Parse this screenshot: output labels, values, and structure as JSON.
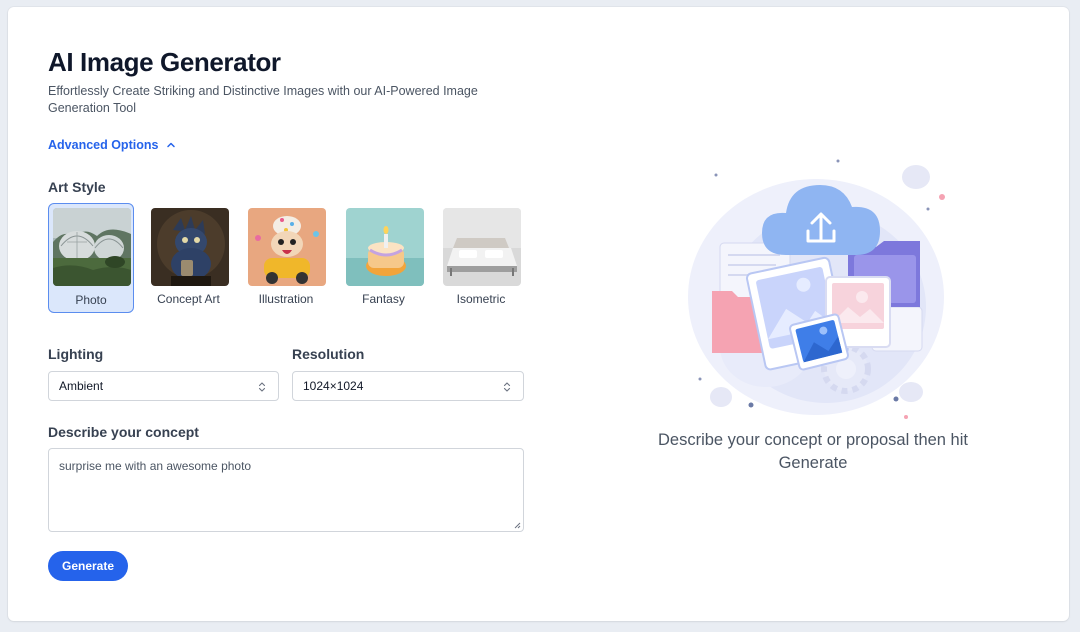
{
  "header": {
    "title": "AI Image Generator",
    "subtitle": "Effortlessly Create Striking and Distinctive Images with our AI-Powered Image Generation Tool"
  },
  "advanced_options": {
    "label": "Advanced Options",
    "expanded": true
  },
  "art_style": {
    "label": "Art Style",
    "selected": "Photo",
    "options": [
      {
        "label": "Photo"
      },
      {
        "label": "Concept Art"
      },
      {
        "label": "Illustration"
      },
      {
        "label": "Fantasy"
      },
      {
        "label": "Isometric"
      }
    ]
  },
  "lighting": {
    "label": "Lighting",
    "value": "Ambient"
  },
  "resolution": {
    "label": "Resolution",
    "value": "1024×1024"
  },
  "concept": {
    "label": "Describe your concept",
    "placeholder": "surprise me with an awesome photo"
  },
  "generate_button": {
    "label": "Generate"
  },
  "empty_state": {
    "text": "Describe your concept or proposal then hit Generate"
  },
  "colors": {
    "accent": "#2563eb",
    "selected_bg": "#dbe7fb",
    "selected_border": "#5b8def"
  }
}
